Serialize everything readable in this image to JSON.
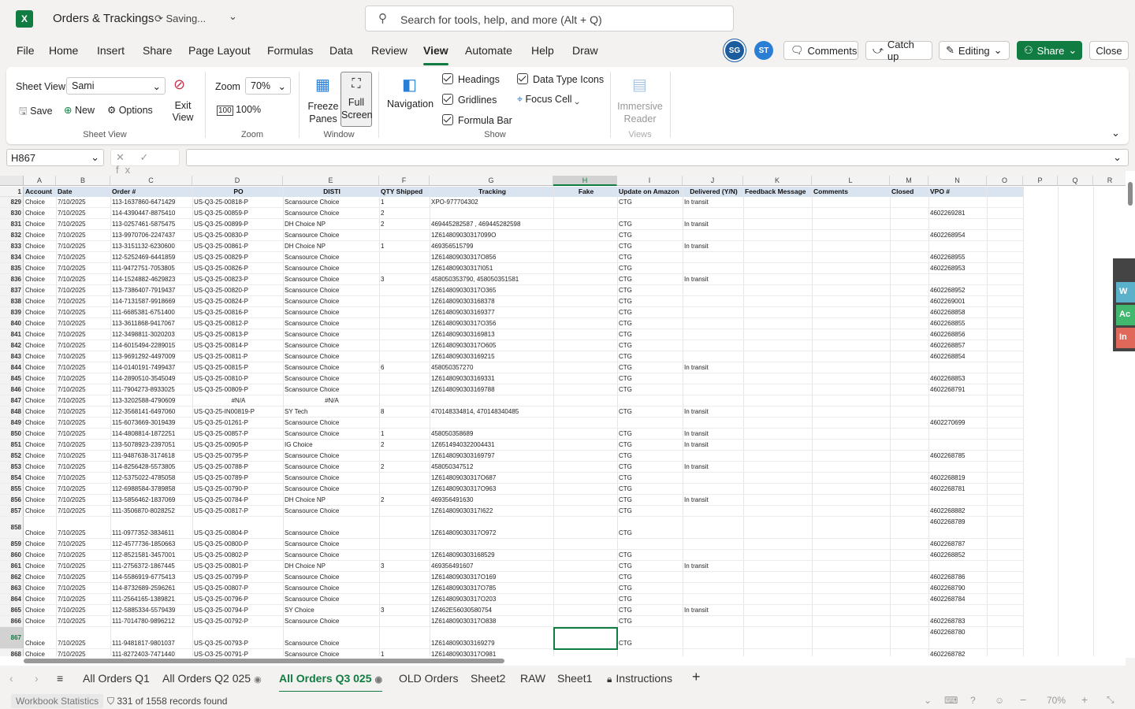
{
  "app": {
    "title": "Orders & Trackings",
    "status": "Saving...",
    "search_placeholder": "Search for tools, help, and more (Alt + Q)"
  },
  "menu": [
    "File",
    "Home",
    "Insert",
    "Share",
    "Page Layout",
    "Formulas",
    "Data",
    "Review",
    "View",
    "Automate",
    "Help",
    "Draw"
  ],
  "menu_active": "View",
  "avatars": [
    {
      "initials": "SG",
      "color": "#1b5c9e"
    },
    {
      "initials": "ST",
      "color": "#2a7fd4"
    }
  ],
  "toolbar": {
    "comments": "Comments",
    "catchup": "Catch up",
    "editing": "Editing",
    "share": "Share",
    "close": "Close"
  },
  "ribbon": {
    "sheet_view_label": "Sheet View",
    "sheet_view_value": "Sami",
    "save": "Save",
    "new": "New",
    "options": "Options",
    "exit_view": "Exit View",
    "group_sheet_view": "Sheet View",
    "zoom_label": "Zoom",
    "zoom_value": "70%",
    "zoom_100": "100%",
    "group_zoom": "Zoom",
    "freeze_panes": "Freeze Panes",
    "full_screen": "Full Screen",
    "group_window": "Window",
    "navigation": "Navigation",
    "headings": "Headings",
    "gridlines": "Gridlines",
    "formula_bar": "Formula Bar",
    "data_type_icons": "Data Type Icons",
    "focus_cell": "Focus Cell",
    "group_show": "Show",
    "immersive_reader": "Immersive Reader",
    "group_views": "Views"
  },
  "namebox": "H867",
  "fx_buttons": "✕ ✓ fx",
  "columns": [
    "A",
    "B",
    "C",
    "D",
    "E",
    "F",
    "G",
    "H",
    "I",
    "J",
    "K",
    "L",
    "M",
    "N",
    "O",
    "P",
    "Q",
    "R"
  ],
  "header_row_num": "1",
  "headers": [
    "Account",
    "Date",
    "Order #",
    "PO",
    "DISTI",
    "QTY Shipped",
    "Tracking",
    "Fake",
    "Update on Amazon",
    "Delivered (Y/N)",
    "Feedback Message",
    "Comments",
    "Closed",
    "VPO #",
    "",
    "",
    "",
    ""
  ],
  "rows": [
    {
      "n": "829",
      "v": [
        "Choice",
        "7/10/2025",
        "113-1637860-6471429",
        "US-Q3-25-00818-P",
        "Scansource Choice",
        "1",
        "XPO-977704302",
        "",
        "CTG",
        "In transit",
        "",
        "",
        "",
        ""
      ]
    },
    {
      "n": "830",
      "v": [
        "Choice",
        "7/10/2025",
        "114-4390447-8875410",
        "US-Q3-25-00859-P",
        "Scansource Choice",
        "2",
        "",
        "",
        "",
        "",
        "",
        "",
        "",
        "4602269281"
      ]
    },
    {
      "n": "831",
      "v": [
        "Choice",
        "7/10/2025",
        "113-0257461-5875475",
        "US-Q3-25-00899-P",
        "DH Choice NP",
        "2",
        "469445282587 , 469445282598",
        "",
        "CTG",
        "In transit",
        "",
        "",
        "",
        ""
      ]
    },
    {
      "n": "832",
      "v": [
        "Choice",
        "7/10/2025",
        "113-9970706-2247437",
        "US-Q3-25-00830-P",
        "Scansource Choice",
        "",
        "1Z614809030317099O",
        "",
        "CTG",
        "",
        "",
        "",
        "",
        "4602268954"
      ]
    },
    {
      "n": "833",
      "v": [
        "Choice",
        "7/10/2025",
        "113-3151132-6230600",
        "US-Q3-25-00861-P",
        "DH Choice NP",
        "1",
        "469356515799",
        "",
        "CTG",
        "In transit",
        "",
        "",
        "",
        ""
      ]
    },
    {
      "n": "834",
      "v": [
        "Choice",
        "7/10/2025",
        "112-5252469-6441859",
        "US-Q3-25-00829-P",
        "Scansource Choice",
        "",
        "1Z614809030317O856",
        "",
        "CTG",
        "",
        "",
        "",
        "",
        "4602268955"
      ]
    },
    {
      "n": "835",
      "v": [
        "Choice",
        "7/10/2025",
        "111-9472751-7053805",
        "US-Q3-25-00826-P",
        "Scansource Choice",
        "",
        "1Z614809030317I051",
        "",
        "CTG",
        "",
        "",
        "",
        "",
        "4602268953"
      ]
    },
    {
      "n": "836",
      "v": [
        "Choice",
        "7/10/2025",
        "114-1524882-4629823",
        "US-Q3-25-00823-P",
        "Scansource Choice",
        "3",
        "458050353790, 458050351581",
        "",
        "CTG",
        "In transit",
        "",
        "",
        "",
        ""
      ]
    },
    {
      "n": "837",
      "v": [
        "Choice",
        "7/10/2025",
        "113-7386407-7919437",
        "US-Q3-25-00820-P",
        "Scansource Choice",
        "",
        "1Z614809030317O365",
        "",
        "CTG",
        "",
        "",
        "",
        "",
        "4602268952"
      ]
    },
    {
      "n": "838",
      "v": [
        "Choice",
        "7/10/2025",
        "114-7131587-9918669",
        "US-Q3-25-00824-P",
        "Scansource Choice",
        "",
        "1Z6148090303168378",
        "",
        "CTG",
        "",
        "",
        "",
        "",
        "4602269001"
      ]
    },
    {
      "n": "839",
      "v": [
        "Choice",
        "7/10/2025",
        "111-6685381-6751400",
        "US-Q3-25-00816-P",
        "Scansource Choice",
        "",
        "1Z6148090303169377",
        "",
        "CTG",
        "",
        "",
        "",
        "",
        "4602268858"
      ]
    },
    {
      "n": "840",
      "v": [
        "Choice",
        "7/10/2025",
        "113-3611868-9417067",
        "US-Q3-25-00812-P",
        "Scansource Choice",
        "",
        "1Z614809030317O356",
        "",
        "CTG",
        "",
        "",
        "",
        "",
        "4602268855"
      ]
    },
    {
      "n": "841",
      "v": [
        "Choice",
        "7/10/2025",
        "112-3498811-3020203",
        "US-Q3-25-00813-P",
        "Scansource Choice",
        "",
        "1Z6148090303169813",
        "",
        "CTG",
        "",
        "",
        "",
        "",
        "4602268856"
      ]
    },
    {
      "n": "842",
      "v": [
        "Choice",
        "7/10/2025",
        "114-6015494-2289015",
        "US-Q3-25-00814-P",
        "Scansource Choice",
        "",
        "1Z614809030317O605",
        "",
        "CTG",
        "",
        "",
        "",
        "",
        "4602268857"
      ]
    },
    {
      "n": "843",
      "v": [
        "Choice",
        "7/10/2025",
        "113-9691292-4497009",
        "US-Q3-25-00811-P",
        "Scansource Choice",
        "",
        "1Z6148090303169215",
        "",
        "CTG",
        "",
        "",
        "",
        "",
        "4602268854"
      ]
    },
    {
      "n": "844",
      "v": [
        "Choice",
        "7/10/2025",
        "114-0140191-7499437",
        "US-Q3-25-00815-P",
        "Scansource Choice",
        "6",
        "458050357270",
        "",
        "CTG",
        "In transit",
        "",
        "",
        "",
        ""
      ]
    },
    {
      "n": "845",
      "v": [
        "Choice",
        "7/10/2025",
        "114-2890510-3545049",
        "US-Q3-25-00810-P",
        "Scansource Choice",
        "",
        "1Z6148090303169331",
        "",
        "CTG",
        "",
        "",
        "",
        "",
        "4602268853"
      ]
    },
    {
      "n": "846",
      "v": [
        "Choice",
        "7/10/2025",
        "111-7904273-8933025",
        "US-Q3-25-00809-P",
        "Scansource Choice",
        "",
        "1Z6148090303169788",
        "",
        "CTG",
        "",
        "",
        "",
        "",
        "4602268791"
      ]
    },
    {
      "n": "847",
      "v": [
        "Choice",
        "7/10/2025",
        "113-3202588-4790609",
        "#N/A",
        "#N/A",
        "",
        "",
        "",
        "",
        "",
        "",
        "",
        "",
        ""
      ]
    },
    {
      "n": "848",
      "v": [
        "Choice",
        "7/10/2025",
        "112-3568141-6497060",
        "US-Q3-25-IN00819-P",
        "SY Tech",
        "8",
        "470148334814, 470148340485",
        "",
        "CTG",
        "In transit",
        "",
        "",
        "",
        ""
      ]
    },
    {
      "n": "849",
      "v": [
        "Choice",
        "7/10/2025",
        "115-6073669-3019439",
        "US-Q3-25-01261-P",
        "Scansource Choice",
        "",
        "",
        "",
        "",
        "",
        "",
        "",
        "",
        "4602270699"
      ]
    },
    {
      "n": "850",
      "v": [
        "Choice",
        "7/10/2025",
        "114-4808814-1872251",
        "US-Q3-25-00857-P",
        "Scansource Choice",
        "1",
        "458050358689",
        "",
        "CTG",
        "In transit",
        "",
        "",
        "",
        ""
      ]
    },
    {
      "n": "851",
      "v": [
        "Choice",
        "7/10/2025",
        "113-5078923-2397051",
        "US-Q3-25-00905-P",
        "IG Choice",
        "2",
        "1Z6514940322004431",
        "",
        "CTG",
        "In transit",
        "",
        "",
        "",
        ""
      ]
    },
    {
      "n": "852",
      "v": [
        "Choice",
        "7/10/2025",
        "111-9487638-3174618",
        "US-Q3-25-00795-P",
        "Scansource Choice",
        "",
        "1Z6148090303169797",
        "",
        "CTG",
        "",
        "",
        "",
        "",
        "4602268785"
      ]
    },
    {
      "n": "853",
      "v": [
        "Choice",
        "7/10/2025",
        "114-8256428-5573805",
        "US-Q3-25-00788-P",
        "Scansource Choice",
        "2",
        "458050347512",
        "",
        "CTG",
        "In transit",
        "",
        "",
        "",
        ""
      ]
    },
    {
      "n": "854",
      "v": [
        "Choice",
        "7/10/2025",
        "112-5375022-4785058",
        "US-Q3-25-00789-P",
        "Scansource Choice",
        "",
        "1Z614809030317O687",
        "",
        "CTG",
        "",
        "",
        "",
        "",
        "4602268819"
      ]
    },
    {
      "n": "855",
      "v": [
        "Choice",
        "7/10/2025",
        "112-6988584-3789858",
        "US-Q3-25-00790-P",
        "Scansource Choice",
        "",
        "1Z614809030317O963",
        "",
        "CTG",
        "",
        "",
        "",
        "",
        "4602268781"
      ]
    },
    {
      "n": "856",
      "v": [
        "Choice",
        "7/10/2025",
        "113-5856462-1837069",
        "US-Q3-25-00784-P",
        "DH Choice NP",
        "2",
        "469356491630",
        "",
        "CTG",
        "In transit",
        "",
        "",
        "",
        ""
      ]
    },
    {
      "n": "857",
      "v": [
        "Choice",
        "7/10/2025",
        "111-3506870-8028252",
        "US-Q3-25-00817-P",
        "Scansource Choice",
        "",
        "1Z614809030317I622",
        "",
        "CTG",
        "",
        "",
        "",
        "",
        "4602268882"
      ]
    },
    {
      "n": "858",
      "tall": true,
      "n_extra": "4602268789",
      "v": [
        "Choice",
        "7/10/2025",
        "111-0977352-3834611",
        "US-Q3-25-00804-P",
        "Scansource Choice",
        "",
        "1Z614809030317O972",
        "",
        "CTG",
        "",
        "",
        "",
        "",
        ""
      ]
    },
    {
      "n": "859",
      "v": [
        "Choice",
        "7/10/2025",
        "112-4577736-1850663",
        "US-Q3-25-00800-P",
        "Scansource Choice",
        "",
        "",
        "",
        "",
        "",
        "",
        "",
        "",
        "4602268787"
      ]
    },
    {
      "n": "860",
      "v": [
        "Choice",
        "7/10/2025",
        "112-8521581-3457001",
        "US-Q3-25-00802-P",
        "Scansource Choice",
        "",
        "1Z6148090303168529",
        "",
        "CTG",
        "",
        "",
        "",
        "",
        "4602268852"
      ]
    },
    {
      "n": "861",
      "v": [
        "Choice",
        "7/10/2025",
        "111-2756372-1867445",
        "US-Q3-25-00801-P",
        "DH Choice NP",
        "3",
        "469356491607",
        "",
        "CTG",
        "In transit",
        "",
        "",
        "",
        ""
      ]
    },
    {
      "n": "862",
      "v": [
        "Choice",
        "7/10/2025",
        "114-5586919-6775413",
        "US-Q3-25-00799-P",
        "Scansource Choice",
        "",
        "1Z614809030317O169",
        "",
        "CTG",
        "",
        "",
        "",
        "",
        "4602268786"
      ]
    },
    {
      "n": "863",
      "v": [
        "Choice",
        "7/10/2025",
        "114-8732689-2596261",
        "US-Q3-25-00807-P",
        "Scansource Choice",
        "",
        "1Z614809030317O785",
        "",
        "CTG",
        "",
        "",
        "",
        "",
        "4602268790"
      ]
    },
    {
      "n": "864",
      "v": [
        "Choice",
        "7/10/2025",
        "111-2564165-1389821",
        "US-Q3-25-00796-P",
        "Scansource Choice",
        "",
        "1Z614809030317O203",
        "",
        "CTG",
        "",
        "",
        "",
        "",
        "4602268784"
      ]
    },
    {
      "n": "865",
      "v": [
        "Choice",
        "7/10/2025",
        "112-5885334-5579439",
        "US-Q3-25-00794-P",
        "SY Choice",
        "3",
        "1Z462E56030580754",
        "",
        "CTG",
        "In transit",
        "",
        "",
        "",
        ""
      ]
    },
    {
      "n": "866",
      "v": [
        "Choice",
        "7/10/2025",
        "111-7014780-9896212",
        "US-Q3-25-00792-P",
        "Scansource Choice",
        "",
        "1Z614809030317O838",
        "",
        "CTG",
        "",
        "",
        "",
        "",
        "4602268783"
      ]
    },
    {
      "n": "867",
      "tall": true,
      "sel": true,
      "n_extra": "4602268780",
      "v": [
        "Choice",
        "7/10/2025",
        "111-9481817-9801037",
        "US-Q3-25-00793-P",
        "Scansource Choice",
        "",
        "1Z6148090303169279",
        "",
        "CTG",
        "",
        "",
        "",
        "",
        ""
      ]
    },
    {
      "n": "868",
      "v": [
        "Choice",
        "7/10/2025",
        "111-8272403-7471440",
        "US-Q3-25-00791-P",
        "Scansource Choice",
        "1",
        "1Z614809030317O981",
        "",
        "",
        "",
        "",
        "",
        "",
        "4602268782"
      ]
    }
  ],
  "side_tabs": [
    {
      "t": "W",
      "c": "#5ab1c9"
    },
    {
      "t": "Ac",
      "c": "#41b86e"
    },
    {
      "t": "In",
      "c": "#e0685b"
    }
  ],
  "sheet_tabs": [
    "All Orders Q1",
    "All Orders Q2 025",
    "All Orders Q3 025",
    "OLD Orders",
    "Sheet2",
    "RAW",
    "Sheet1",
    "Instructions"
  ],
  "sheet_active": "All Orders Q3 025",
  "status": {
    "workbook_stats": "Workbook Statistics",
    "records": "331 of 1558 records found",
    "zoom": "70%"
  }
}
